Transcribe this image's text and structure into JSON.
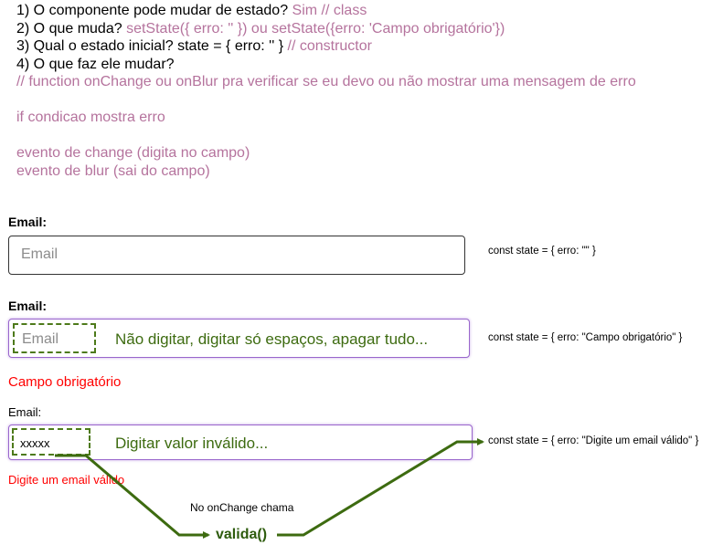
{
  "notes": {
    "q1_text": "1) O componente pode mudar de estado? ",
    "q1_answer": "Sim // class",
    "q2_text": "2) O que muda? ",
    "q2_answer": "setState({ erro: '' }) ou setState({erro: 'Campo obrigatório'})",
    "q3_text": "3) Qual o estado inicial? state = { erro: '' } ",
    "q3_answer": "// constructor",
    "q4_text": "4) O que faz ele mudar?",
    "comment": "// function onChange ou onBlur pra verificar se eu devo ou não mostrar uma mensagem de erro",
    "condition": "if condicao mostra erro",
    "event_change": "evento de change (digita no campo)",
    "event_blur": "evento de blur (sai do campo)"
  },
  "field1": {
    "label": "Email:",
    "placeholder": "Email",
    "state": "const state = { erro: \"\" }"
  },
  "field2": {
    "label": "Email:",
    "placeholder": "Email",
    "hint": "Não digitar, digitar só espaços, apagar tudo...",
    "state": "const state = { erro: \"Campo obrigatório\" }",
    "error": "Campo obrigatório"
  },
  "field3": {
    "label": "Email:",
    "value": "xxxxx",
    "hint": "Digitar valor inválido...",
    "state": "const state = { erro: \"Digite um email válido\" }",
    "error": "Digite um email válido"
  },
  "flow": {
    "caption": "No onChange chama",
    "function": "valida()"
  },
  "colors": {
    "note_purple": "#b5739d",
    "arrow_green": "#3d6b10",
    "error_red": "#ff0000",
    "focus_purple": "#9966cc"
  }
}
